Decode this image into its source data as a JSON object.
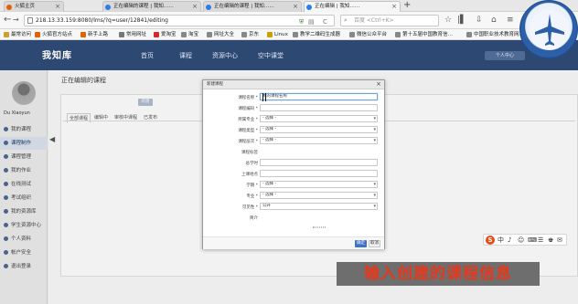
{
  "browser": {
    "tabs": [
      {
        "label": "火狐主页",
        "active": false
      },
      {
        "label": "正在编辑的课程 | 我知……",
        "active": false
      },
      {
        "label": "正在编辑的课程 | 我知……",
        "active": false
      },
      {
        "label": "正在编辑 | 我知……",
        "active": true
      }
    ],
    "new_tab_label": "+",
    "url": "218.13.33.159:8080/lms/?q=user/12841/editing",
    "search_placeholder": "百度 <Ctrl+K>",
    "nav": {
      "back": "←",
      "forward": "→",
      "reload": "C",
      "home": "⌂",
      "download": "⇩",
      "bookmark_star": "☆",
      "menu": "≡"
    }
  },
  "bookmarks": [
    "最常访问",
    "火狐官方站点",
    "新手上路",
    "常用网址",
    "爱淘宝",
    "淘宝",
    "网址大全",
    "京东",
    "Linux",
    "教学二维码生成器",
    "微信公众平台",
    "第十五届中国教育信…",
    "中国职业技术教育网…"
  ],
  "site": {
    "brand": "我知库",
    "brand_sub": "",
    "nav": [
      "首页",
      "课程",
      "资源中心",
      "空中课堂"
    ],
    "header_button": "个人中心"
  },
  "sidebar": {
    "username": "Du Xiaoyun",
    "items": [
      {
        "label": "我的课程",
        "active": false
      },
      {
        "label": "课程制作",
        "active": true
      },
      {
        "label": "课程管理",
        "active": false
      },
      {
        "label": "我的作业",
        "active": false
      },
      {
        "label": "在线测试",
        "active": false
      },
      {
        "label": "考试组织",
        "active": false
      },
      {
        "label": "我的资源库",
        "active": false
      },
      {
        "label": "学生资源中心",
        "active": false
      },
      {
        "label": "个人资料",
        "active": false
      },
      {
        "label": "帐户安全",
        "active": false
      },
      {
        "label": "退出登录",
        "active": false
      }
    ]
  },
  "main": {
    "title": "正在编辑的课程",
    "create_button": "新建",
    "tabs": [
      "全部课程",
      "编辑中",
      "审核中课程",
      "已发布"
    ]
  },
  "modal": {
    "title": "新建课程",
    "close": "×",
    "fields": [
      {
        "label": "课程名称 *",
        "value": "我的课程名称",
        "type": "text",
        "focused": true
      },
      {
        "label": "课程编码 *",
        "value": "",
        "type": "text"
      },
      {
        "label": "所属专业 *",
        "value": "- 选择 -",
        "type": "select"
      },
      {
        "label": "课程类型 *",
        "value": "- 选择 -",
        "type": "select"
      },
      {
        "label": "课程层次 *",
        "value": "- 选择 -",
        "type": "select"
      },
      {
        "label": "课程标签",
        "value": "",
        "type": "none"
      },
      {
        "label": "总学时",
        "value": "",
        "type": "text"
      },
      {
        "label": "上课地点",
        "value": "",
        "type": "text"
      },
      {
        "label": "学期 *",
        "value": "- 选择 -",
        "type": "select"
      },
      {
        "label": "专业 *",
        "value": "- 选择 -",
        "type": "select"
      },
      {
        "label": "可见性 *",
        "value": "公开",
        "type": "select"
      },
      {
        "label": "简介",
        "value": "",
        "type": "none"
      }
    ],
    "ok_label": "确定",
    "cancel_label": "取消"
  },
  "ime": {
    "logo": "S",
    "icons": [
      "中",
      "♪",
      "☺",
      "⌨",
      "☰",
      "♚",
      "✉"
    ]
  },
  "caption": "输入创建的课程信息"
}
